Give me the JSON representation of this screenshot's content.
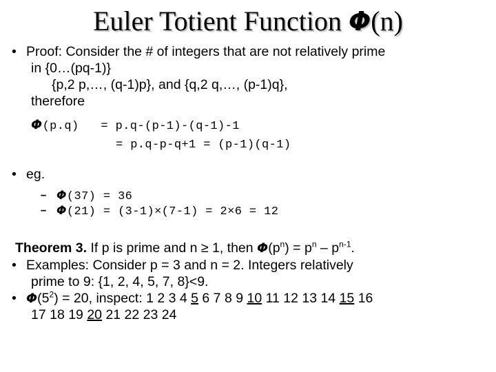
{
  "slide": {
    "title_prefix": "Euler Totient Function ",
    "title_symbol": "Φ",
    "title_suffix": "(n)",
    "bullet_glyph": "•",
    "dash_glyph": "–",
    "proof": {
      "line1": "Proof: Consider the # of integers that are not relatively prime",
      "line2": "in {0…(pq-1)}",
      "line3": "{p,2 p,…, (q-1)p}, and {q,2 q,…, (p-1)q},",
      "line4": "therefore"
    },
    "formula": {
      "symbol": "Φ",
      "lhs": "(p.q)",
      "line1_rhs": "=  p.q-(p-1)-(q-1)-1",
      "line2_rhs": "=  p.q-p-q+1 =  (p-1)(q-1)"
    },
    "eg": {
      "label": "eg.",
      "items": [
        {
          "symbol": "Φ",
          "text": "(37) = 36"
        },
        {
          "symbol": "Φ",
          "text": "(21) = (3-1)×(7-1) = 2×6 = 12"
        }
      ]
    },
    "theorem": {
      "label": "Theorem 3.",
      "text_a": " If p is prime and n ≥ 1, then ",
      "symbol": "Φ",
      "text_b": "(p",
      "sup1": "n",
      "text_c": ") = p",
      "sup2": "n",
      "text_d": " – p",
      "sup3": "n-1",
      "text_e": "."
    },
    "examples": {
      "line1": "Examples: Consider p = 3 and n = 2. Integers relatively",
      "line2": "prime to 9: {1, 2, 4, 5, 7, 8}<9."
    },
    "inspect": {
      "symbol": "Φ",
      "prefix": "(5",
      "sup": "2",
      "mid": ") = 20, inspect: 1 2 3 4 ",
      "u1": "5",
      "seg2": " 6 7 8 9 ",
      "u2": "10",
      "seg3": " 11 12 13 14 ",
      "u3": "15",
      "seg4": " 16",
      "line2_a": "17 18 19 ",
      "u4": "20",
      "line2_b": " 21 22 23 24"
    }
  }
}
